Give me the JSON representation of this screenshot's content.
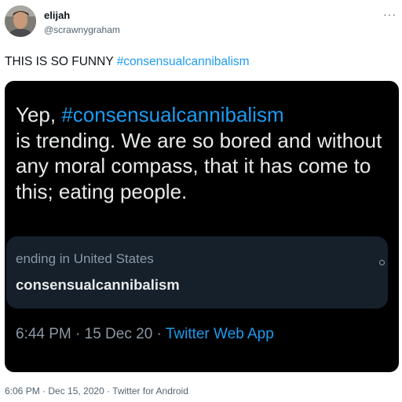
{
  "author": {
    "name": "elijah",
    "handle": "@scrawnygraham"
  },
  "menu_icon": "more-horizontal-icon",
  "tweet": {
    "text_plain": "THIS IS SO FUNNY ",
    "hashtag": "#consensualcannibalism"
  },
  "embedded_screenshot": {
    "prefix": "Yep, ",
    "hashtag": "#consensualcannibalism",
    "body": "is trending. We are so bored and without any moral compass, that it has come to this; eating people.",
    "trend_context": "ending in United States",
    "trend_name": "consensualcannibalism",
    "timestamp": "6:44 PM · 15 Dec 20 · ",
    "source": "Twitter Web App"
  },
  "footer": {
    "timestamp": "6:06 PM · Dec 15, 2020 · Twitter for Android"
  },
  "colors": {
    "link": "#1d9bf0",
    "text": "#0f1419",
    "muted": "#536471",
    "media_bg": "#000000",
    "card_bg": "#15202b"
  }
}
